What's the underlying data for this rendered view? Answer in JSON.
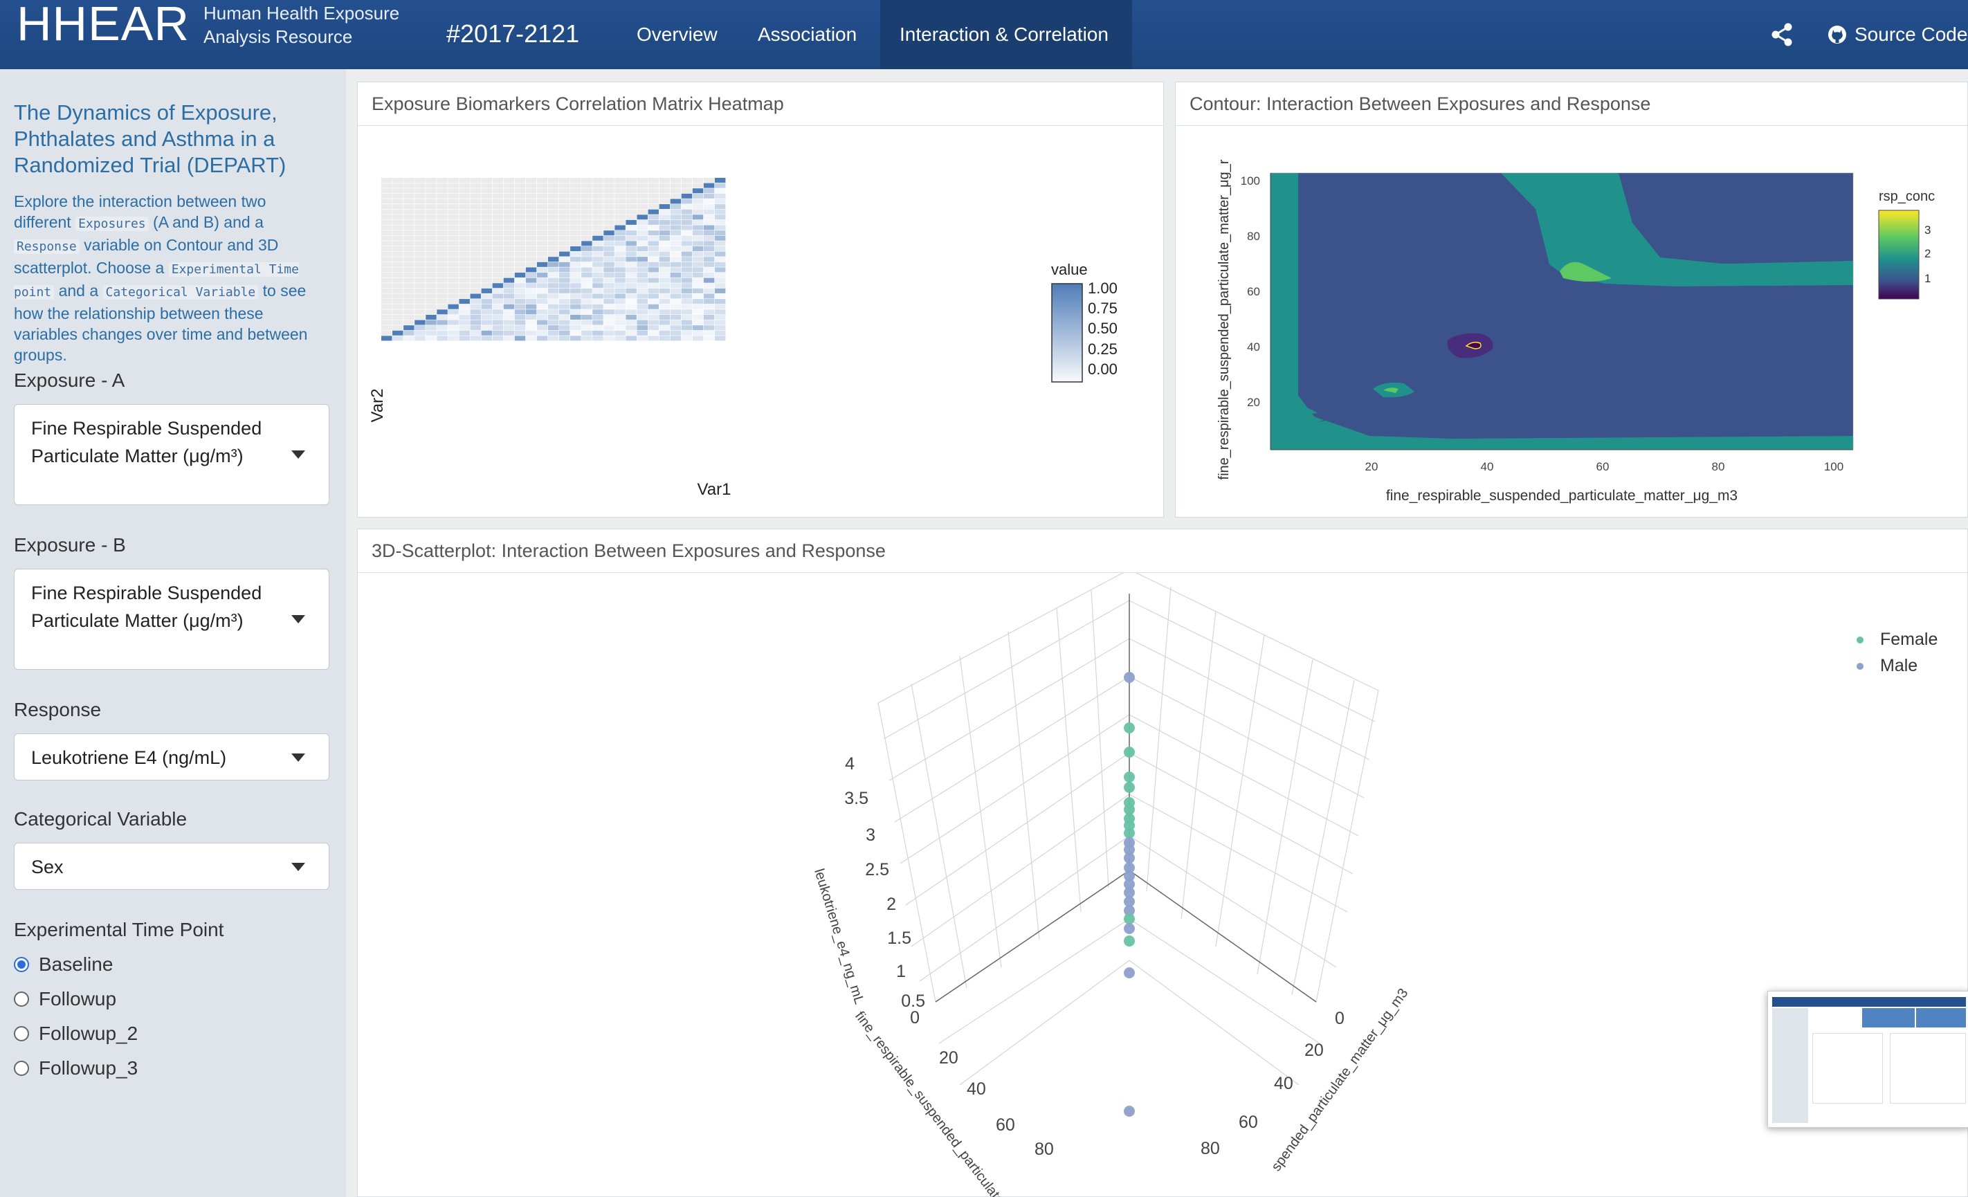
{
  "navbar": {
    "logo": "HHEAR",
    "subtitle_line1": "Human Health Exposure",
    "subtitle_line2": "Analysis Resource",
    "study_id": "#2017-2121",
    "tabs": [
      {
        "label": "Overview"
      },
      {
        "label": "Association"
      },
      {
        "label": "Interaction & Correlation",
        "active": true
      }
    ],
    "source_label": "Source Code",
    "share_icon": "share-icon",
    "source_icon": "github-icon",
    "colors": {
      "bar": "#25508f",
      "active": "#1a3e6f"
    }
  },
  "sidebar": {
    "title": "The Dynamics of Exposure, Phthalates and Asthma in a Randomized Trial (DEPART)",
    "desc": {
      "t1": "Explore the interaction between two different ",
      "c1": "Exposures",
      "t2": " (A and B) and a ",
      "c2": "Response",
      "t3": " variable on Contour and 3D scatterplot. Choose a ",
      "c3": "Experimental Time point",
      "t4": " and a ",
      "c4": "Categorical Variable",
      "t5": " to see how the relationship between these variables changes over time and between groups."
    },
    "exposure_a": {
      "label": "Exposure - A",
      "value": "Fine Respirable Suspended Particulate Matter (μg/m³)"
    },
    "exposure_b": {
      "label": "Exposure - B",
      "value": "Fine Respirable Suspended Particulate Matter (μg/m³)"
    },
    "response": {
      "label": "Response",
      "value": "Leukotriene E4 (ng/mL)"
    },
    "categorical": {
      "label": "Categorical Variable",
      "value": "Sex"
    },
    "timepoint": {
      "label": "Experimental Time Point",
      "options": [
        "Baseline",
        "Followup",
        "Followup_2",
        "Followup_3"
      ],
      "selected": "Baseline"
    }
  },
  "heatmap": {
    "title": "Exposure Biomarkers Correlation Matrix Heatmap",
    "xlabel": "Var1",
    "ylabel": "Var2",
    "legend_title": "value",
    "legend_ticks": [
      "1.00",
      "0.75",
      "0.50",
      "0.25",
      "0.00"
    ],
    "n_vars": 31,
    "colors": {
      "low": "#f7f9fc",
      "high": "#4f7db8",
      "empty": "#ebebeb"
    }
  },
  "contour": {
    "title": "Contour: Interaction Between Exposures and Response",
    "xlabel": "fine_respirable_suspended_particulate_matter_μg_m3",
    "ylabel": "fine_respirable_suspended_particulate_matter_μg_r",
    "xticks": [
      "20",
      "40",
      "60",
      "80",
      "100"
    ],
    "yticks": [
      "100",
      "80",
      "60",
      "40",
      "20"
    ],
    "legend_title": "rsp_conc",
    "legend_ticks": [
      "3",
      "2",
      "1"
    ],
    "colors": [
      "#440154",
      "#3b528b",
      "#21918c",
      "#5ec962",
      "#fde725"
    ]
  },
  "scatter3d": {
    "title": "3D-Scatterplot: Interaction Between Exposures and Response",
    "series": [
      {
        "name": "Female",
        "color": "#66c2a5"
      },
      {
        "name": "Male",
        "color": "#8da0cb"
      }
    ],
    "z_label": "leukotriene_e4_ng_mL",
    "z_ticks": [
      "4",
      "3.5",
      "3",
      "2.5",
      "2",
      "1.5",
      "1",
      "0.5",
      "0"
    ],
    "x_label": "fine_respirable_suspended_particulate",
    "x_ticks": [
      "20",
      "40",
      "60",
      "80"
    ],
    "y_label": "spended_particulate_matter_μg_m3",
    "y_ticks": [
      "0",
      "20",
      "40",
      "60",
      "80"
    ]
  }
}
